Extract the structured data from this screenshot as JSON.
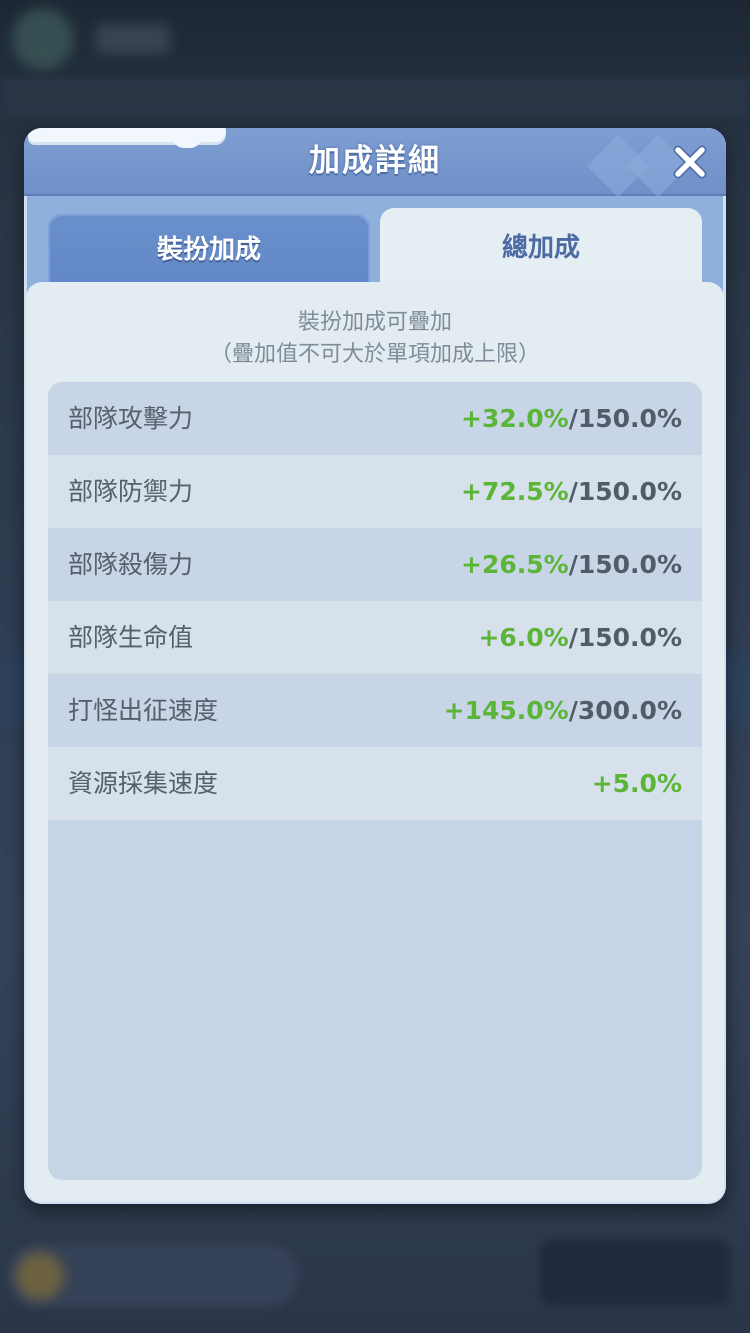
{
  "dialog": {
    "title": "加成詳細",
    "close_icon": "close-icon"
  },
  "tabs": [
    {
      "label": "裝扮加成",
      "selected": false
    },
    {
      "label": "總加成",
      "selected": true
    }
  ],
  "note": {
    "line1": "裝扮加成可疊加",
    "line2": "（疊加值不可大於單項加成上限）"
  },
  "stats": [
    {
      "label": "部隊攻擊力",
      "value": "+32.0%",
      "max": "/150.0%"
    },
    {
      "label": "部隊防禦力",
      "value": "+72.5%",
      "max": "/150.0%"
    },
    {
      "label": "部隊殺傷力",
      "value": "+26.5%",
      "max": "/150.0%"
    },
    {
      "label": "部隊生命值",
      "value": "+6.0%",
      "max": "/150.0%"
    },
    {
      "label": "打怪出征速度",
      "value": "+145.0%",
      "max": "/300.0%"
    },
    {
      "label": "資源採集速度",
      "value": "+5.0%",
      "max": ""
    }
  ],
  "colors": {
    "bonus_value": "#5bb536",
    "header": "#6f90c8",
    "panel": "#e3ecf1"
  }
}
